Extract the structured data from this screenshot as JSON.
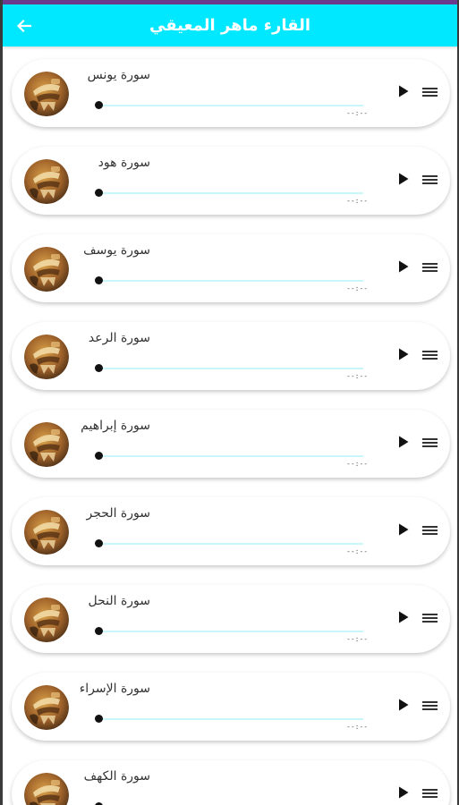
{
  "appbar": {
    "title": "القارء ماهر المعيقي",
    "back_icon": "arrow-left-icon",
    "color": "#00e8ff"
  },
  "tracks": [
    {
      "title": "سورة يونس",
      "time": "--:--",
      "progress": 0
    },
    {
      "title": "سورة هود",
      "time": "--:--",
      "progress": 0
    },
    {
      "title": "سورة يوسف",
      "time": "--:--",
      "progress": 0
    },
    {
      "title": "سورة الرعد",
      "time": "--:--",
      "progress": 0
    },
    {
      "title": "سورة إبراهيم",
      "time": "--:--",
      "progress": 0
    },
    {
      "title": "سورة الحجر",
      "time": "--:--",
      "progress": 0
    },
    {
      "title": "سورة النحل",
      "time": "--:--",
      "progress": 0
    },
    {
      "title": "سورة الإسراء",
      "time": "--:--",
      "progress": 0
    },
    {
      "title": "سورة الكهف",
      "time": "--:--",
      "progress": 0
    }
  ],
  "icons": {
    "play": "play-icon",
    "menu": "menu-icon",
    "avatar": "reciter-avatar"
  },
  "colors": {
    "track": "#c8f6fb",
    "thumb": "#111111"
  }
}
